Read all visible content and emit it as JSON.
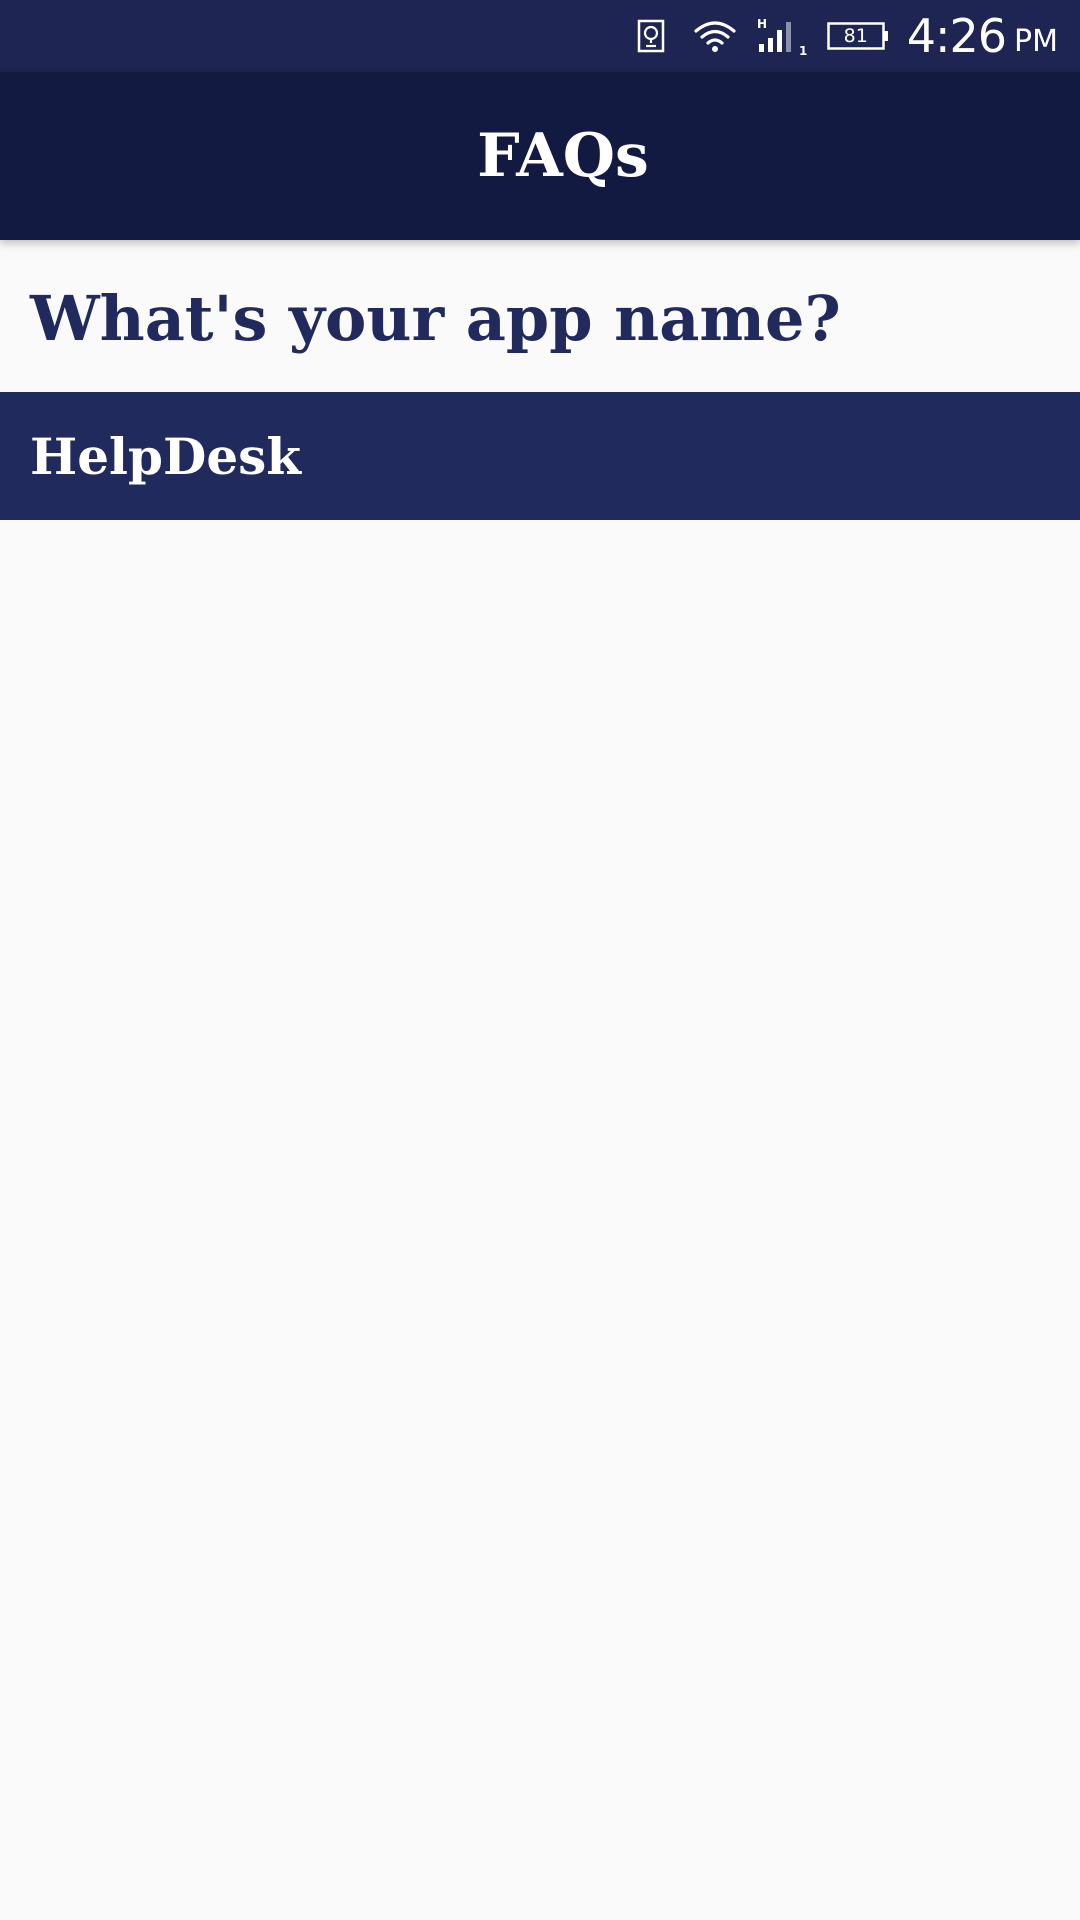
{
  "status_bar": {
    "icons": [
      "sim-card-icon",
      "wifi-icon",
      "signal-icon",
      "battery-icon"
    ],
    "network_type": "H",
    "sim_slot": "1",
    "battery_level": "81",
    "time": "4:26",
    "ampm": "PM"
  },
  "app_bar": {
    "title": "FAQs"
  },
  "faq": {
    "question": "What's your app name?",
    "answer": "HelpDesk"
  },
  "colors": {
    "status_bar_bg": "#1f2552",
    "app_bar_bg": "#131a42",
    "accent": "#212a5c",
    "background": "#fafafa"
  }
}
